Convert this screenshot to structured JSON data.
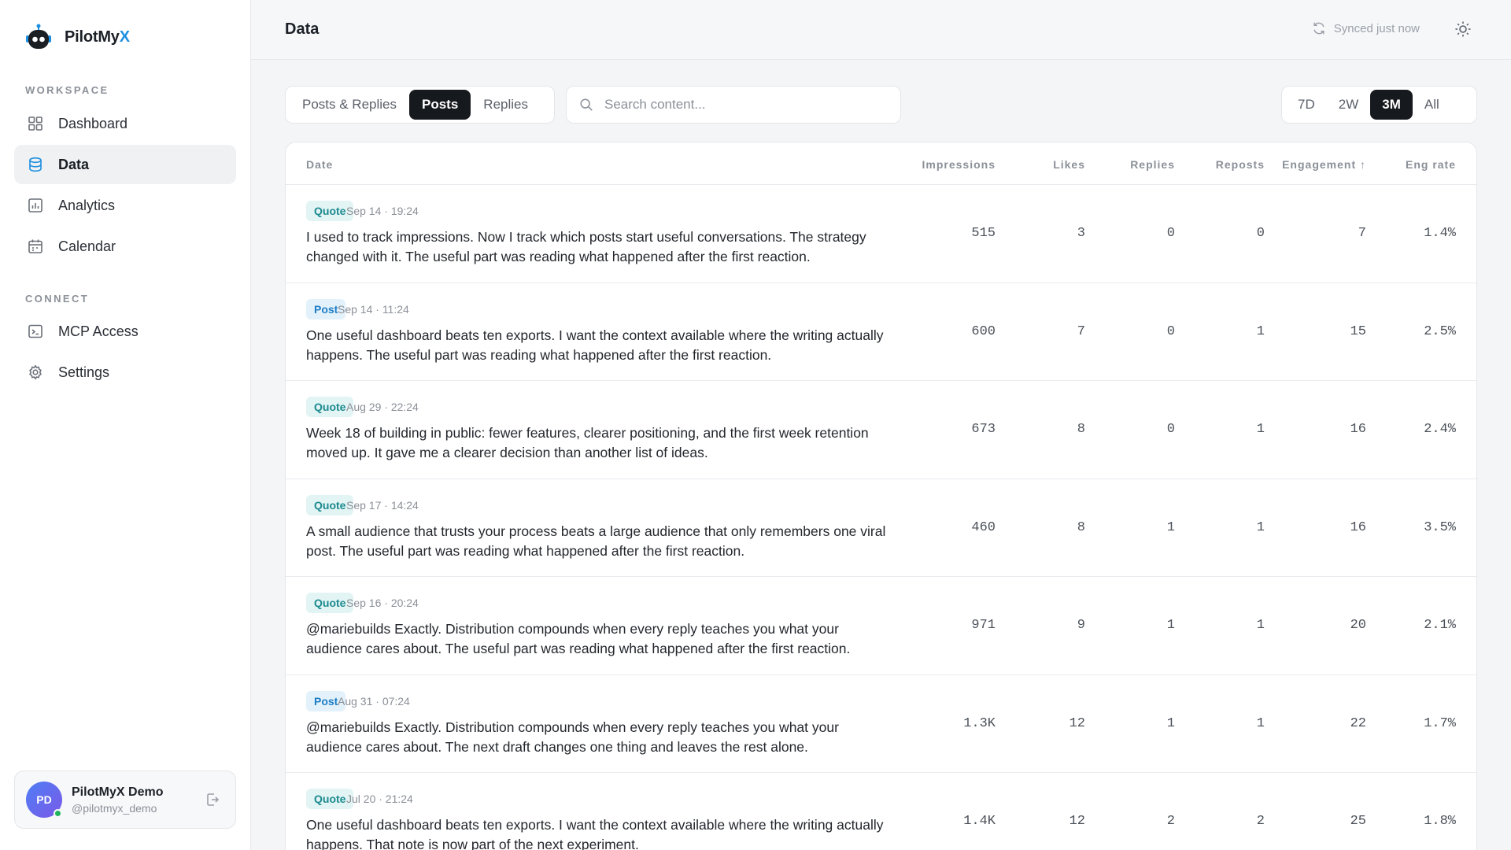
{
  "brand": {
    "name_prefix": "PilotMy",
    "name_suffix": "X"
  },
  "sidebar": {
    "workspace_label": "WORKSPACE",
    "connect_label": "CONNECT",
    "workspace_items": [
      {
        "label": "Dashboard",
        "icon": "grid-icon"
      },
      {
        "label": "Data",
        "icon": "database-icon",
        "active": true
      },
      {
        "label": "Analytics",
        "icon": "bar-chart-icon"
      },
      {
        "label": "Calendar",
        "icon": "calendar-icon"
      }
    ],
    "connect_items": [
      {
        "label": "MCP Access",
        "icon": "terminal-icon"
      },
      {
        "label": "Settings",
        "icon": "gear-icon"
      }
    ],
    "user": {
      "initials": "PD",
      "name": "PilotMyX Demo",
      "handle": "@pilotmyx_demo",
      "status_color": "#22b35e"
    }
  },
  "header": {
    "title": "Data",
    "sync_status": "Synced just now"
  },
  "filters": {
    "type_tabs": [
      "Posts & Replies",
      "Posts",
      "Replies"
    ],
    "type_active": "Posts",
    "search_placeholder": "Search content...",
    "range_tabs": [
      "7D",
      "2W",
      "3M",
      "All"
    ],
    "range_active": "3M"
  },
  "table": {
    "columns": {
      "date": "Date",
      "impressions": "Impressions",
      "likes": "Likes",
      "replies": "Replies",
      "reposts": "Reposts",
      "engagement": "Engagement",
      "eng_rate": "Eng rate"
    },
    "sort_column": "engagement",
    "sort_direction": "ascending",
    "rows": [
      {
        "type": "Quote",
        "date": "Sep 14 · 19:24",
        "text": "I used to track impressions. Now I track which posts start useful conversations. The strategy changed with it. The useful part was reading what happened after the first reaction.",
        "impressions": "515",
        "likes": "3",
        "replies": "0",
        "reposts": "0",
        "engagement": "7",
        "eng_rate": "1.4%"
      },
      {
        "type": "Post",
        "date": "Sep 14 · 11:24",
        "text": "One useful dashboard beats ten exports. I want the context available where the writing actually happens. The useful part was reading what happened after the first reaction.",
        "impressions": "600",
        "likes": "7",
        "replies": "0",
        "reposts": "1",
        "engagement": "15",
        "eng_rate": "2.5%"
      },
      {
        "type": "Quote",
        "date": "Aug 29 · 22:24",
        "text": "Week 18 of building in public: fewer features, clearer positioning, and the first week retention moved up. It gave me a clearer decision than another list of ideas.",
        "impressions": "673",
        "likes": "8",
        "replies": "0",
        "reposts": "1",
        "engagement": "16",
        "eng_rate": "2.4%"
      },
      {
        "type": "Quote",
        "date": "Sep 17 · 14:24",
        "text": "A small audience that trusts your process beats a large audience that only remembers one viral post. The useful part was reading what happened after the first reaction.",
        "impressions": "460",
        "likes": "8",
        "replies": "1",
        "reposts": "1",
        "engagement": "16",
        "eng_rate": "3.5%"
      },
      {
        "type": "Quote",
        "date": "Sep 16 · 20:24",
        "text": "@mariebuilds Exactly. Distribution compounds when every reply teaches you what your audience cares about. The useful part was reading what happened after the first reaction.",
        "impressions": "971",
        "likes": "9",
        "replies": "1",
        "reposts": "1",
        "engagement": "20",
        "eng_rate": "2.1%"
      },
      {
        "type": "Post",
        "date": "Aug 31 · 07:24",
        "text": "@mariebuilds Exactly. Distribution compounds when every reply teaches you what your audience cares about. The next draft changes one thing and leaves the rest alone.",
        "impressions": "1.3K",
        "likes": "12",
        "replies": "1",
        "reposts": "1",
        "engagement": "22",
        "eng_rate": "1.7%"
      },
      {
        "type": "Quote",
        "date": "Jul 20 · 21:24",
        "text": "One useful dashboard beats ten exports. I want the context available where the writing actually happens. That note is now part of the next experiment.",
        "impressions": "1.4K",
        "likes": "12",
        "replies": "2",
        "reposts": "2",
        "engagement": "25",
        "eng_rate": "1.8%"
      }
    ]
  },
  "colors": {
    "accent": "#1d8fe0",
    "active_tab": "#16191d",
    "quote_badge": "#1b8a8f",
    "post_badge": "#1d7ec6"
  }
}
